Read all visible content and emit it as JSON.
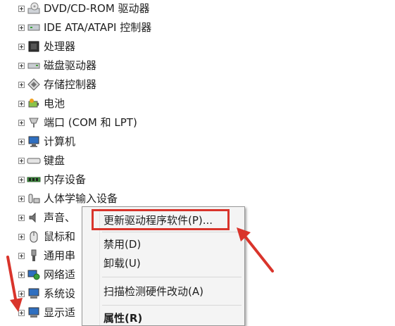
{
  "tree": {
    "items": [
      {
        "label": "DVD/CD-ROM 驱动器",
        "icon": "dvd-drive-icon"
      },
      {
        "label": "IDE ATA/ATAPI 控制器",
        "icon": "ide-controller-icon"
      },
      {
        "label": "处理器",
        "icon": "processor-icon"
      },
      {
        "label": "磁盘驱动器",
        "icon": "disk-drive-icon"
      },
      {
        "label": "存储控制器",
        "icon": "storage-controller-icon"
      },
      {
        "label": "电池",
        "icon": "battery-icon"
      },
      {
        "label": "端口 (COM 和 LPT)",
        "icon": "port-icon"
      },
      {
        "label": "计算机",
        "icon": "computer-icon"
      },
      {
        "label": "键盘",
        "icon": "keyboard-icon"
      },
      {
        "label": "内存设备",
        "icon": "memory-icon"
      },
      {
        "label": "人体学输入设备",
        "icon": "hid-icon"
      },
      {
        "label": "声音、",
        "icon": "sound-icon"
      },
      {
        "label": "鼠标和",
        "icon": "mouse-icon"
      },
      {
        "label": "通用串",
        "icon": "usb-icon"
      },
      {
        "label": "网络适",
        "icon": "network-icon"
      },
      {
        "label": "系统设",
        "icon": "system-icon"
      },
      {
        "label": "显示适",
        "icon": "display-icon"
      }
    ]
  },
  "context_menu": {
    "items": [
      {
        "label": "更新驱动程序软件(P)...",
        "highlighted": true
      },
      {
        "label": "禁用(D)"
      },
      {
        "label": "卸载(U)"
      },
      {
        "label": "扫描检测硬件改动(A)"
      },
      {
        "label": "属性(R)",
        "bold": true
      }
    ]
  },
  "colors": {
    "annotation": "#d9342b"
  }
}
